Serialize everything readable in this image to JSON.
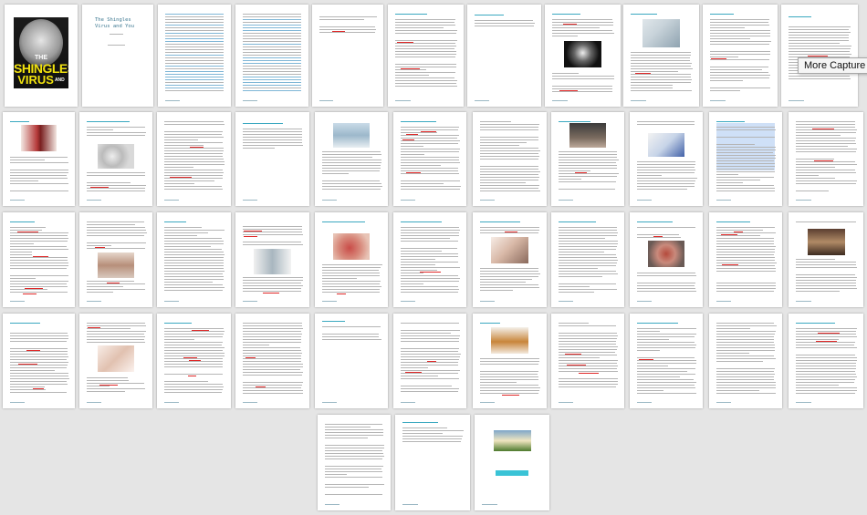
{
  "cover": {
    "title_the": "THE",
    "title_main": "SHINGLES",
    "title_virus": "VIRUS",
    "title_and": "AND",
    "title_you": "YOU"
  },
  "title_page": {
    "line1": "The Shingles",
    "line2": "Virus and You"
  },
  "tooltip": {
    "text": "More Capture Ty"
  },
  "colors": {
    "background": "#e5e5e5",
    "page": "#ffffff",
    "heading_teal": "#3aa8c0",
    "spellcheck_red": "#e02828",
    "cover_yellow": "#f1e20e"
  },
  "thumbnail_count": 51
}
